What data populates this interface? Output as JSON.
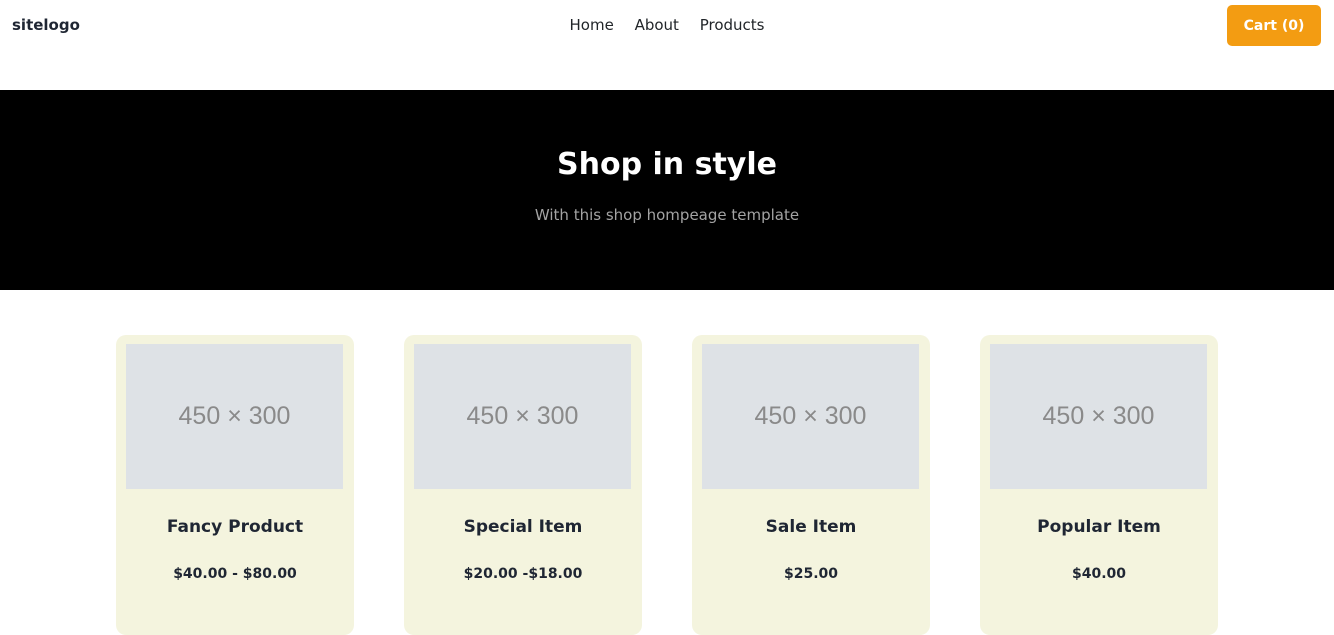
{
  "header": {
    "logo": "sitelogo",
    "nav": [
      "Home",
      "About",
      "Products"
    ],
    "cart": "Cart (0)",
    "cart_color": "#f39c12"
  },
  "hero": {
    "title": "Shop in style",
    "subtitle": "With this shop hompeage template"
  },
  "products": [
    {
      "image": "450 × 300",
      "name": "Fancy Product",
      "price": "$40.00 - $80.00"
    },
    {
      "image": "450 × 300",
      "name": "Special Item",
      "price": "$20.00 -$18.00"
    },
    {
      "image": "450 × 300",
      "name": "Sale Item",
      "price": "$25.00"
    },
    {
      "image": "450 × 300",
      "name": "Popular Item",
      "price": "$40.00"
    }
  ]
}
